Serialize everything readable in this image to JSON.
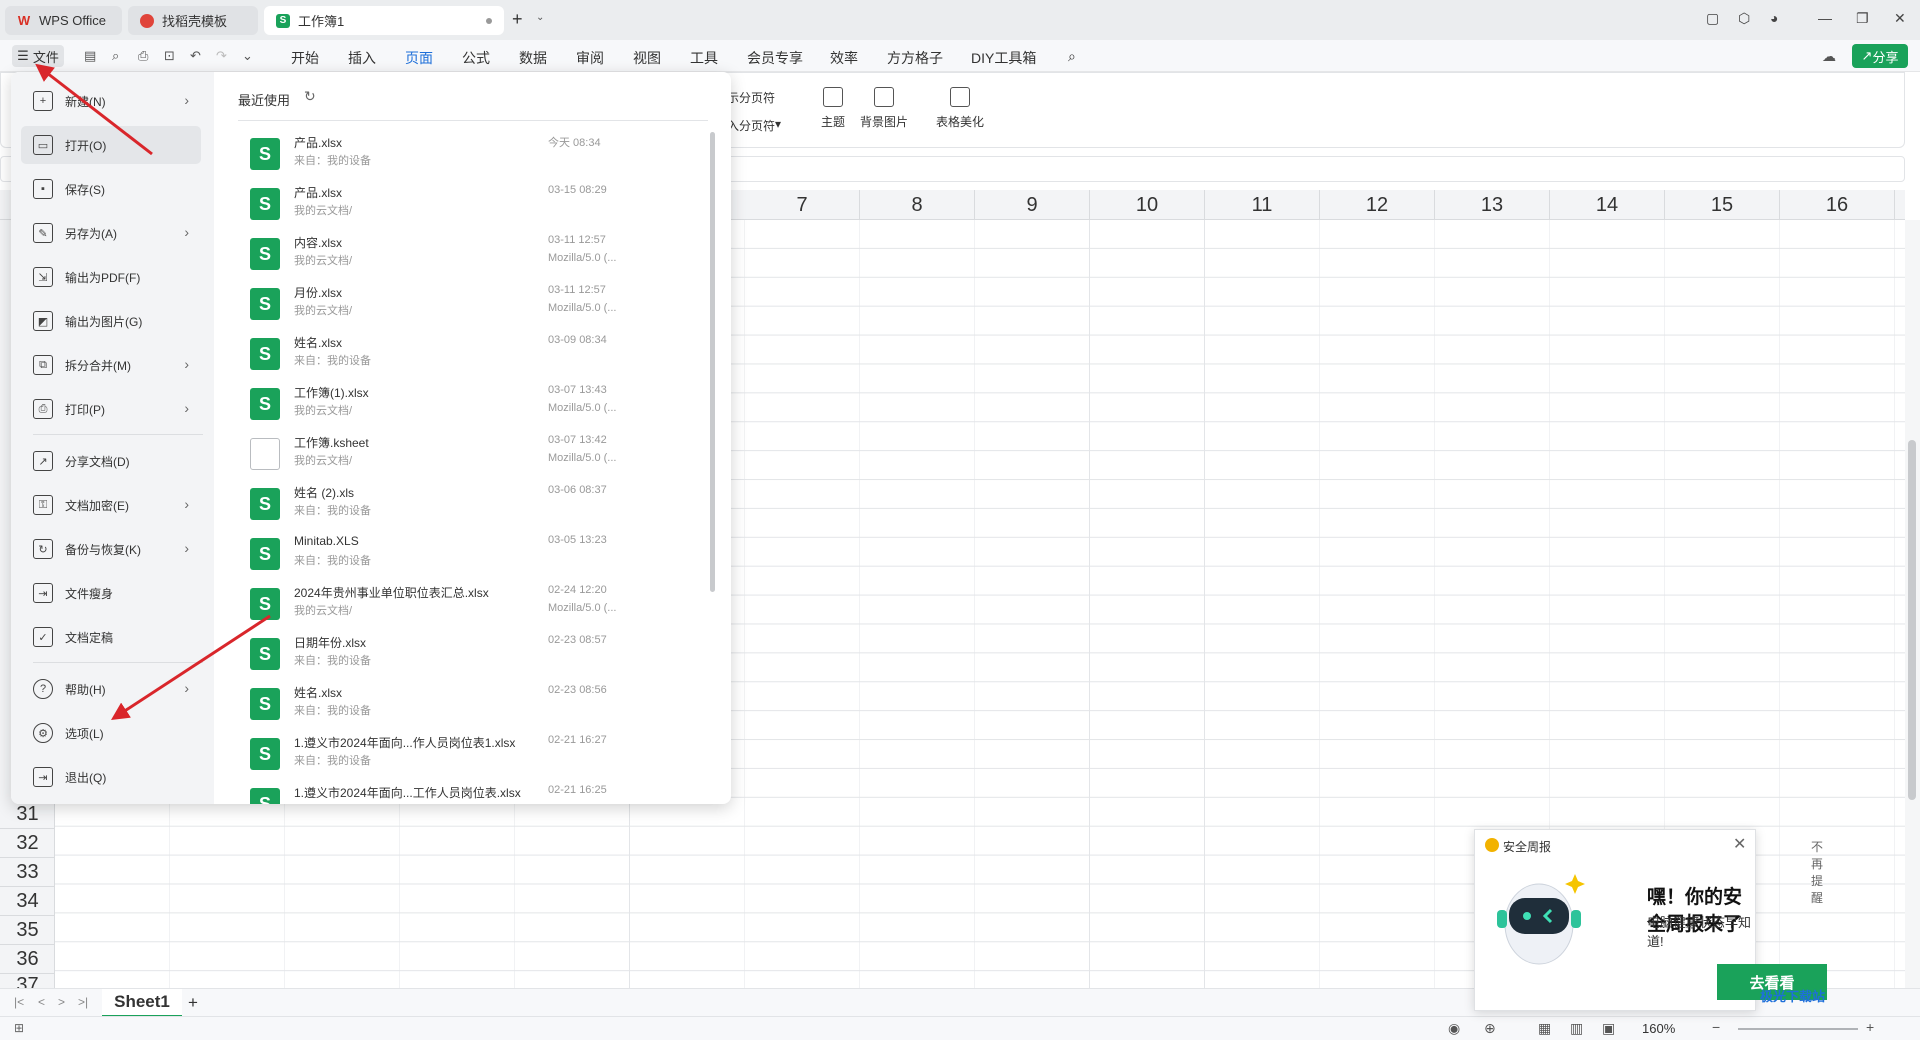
{
  "titlebar": {
    "tabs": [
      {
        "label": "WPS Office"
      },
      {
        "label": "找稻壳模板"
      },
      {
        "label": "工作簿1"
      }
    ]
  },
  "menubar": {
    "file_label": "文件",
    "items": [
      "开始",
      "插入",
      "页面",
      "公式",
      "数据",
      "审阅",
      "视图",
      "工具",
      "会员专享",
      "效率",
      "方方格子",
      "DIY工具箱"
    ],
    "active": "页面",
    "share_label": "分享"
  },
  "ribbon": {
    "partial_items": [
      "示分页符",
      "入分页符"
    ],
    "items": [
      "主题",
      "背景图片",
      "表格美化"
    ]
  },
  "grid": {
    "columns": [
      "7",
      "8",
      "9",
      "10",
      "11",
      "12",
      "13",
      "14",
      "15",
      "16"
    ],
    "rows": [
      "31",
      "32",
      "33",
      "34",
      "35",
      "36",
      "37"
    ]
  },
  "sheets": {
    "tabs": [
      "Sheet1"
    ],
    "zoom": "160%"
  },
  "filemenu": {
    "items": [
      {
        "label": "新建(N)",
        "icon": "new-doc-icon",
        "submenu": true
      },
      {
        "label": "打开(O)",
        "icon": "folder-open-icon",
        "submenu": false,
        "selected": true
      },
      {
        "label": "保存(S)",
        "icon": "save-icon",
        "submenu": false
      },
      {
        "label": "另存为(A)",
        "icon": "save-as-icon",
        "submenu": true
      },
      {
        "label": "输出为PDF(F)",
        "icon": "pdf-icon",
        "submenu": false
      },
      {
        "label": "输出为图片(G)",
        "icon": "image-icon",
        "submenu": false
      },
      {
        "label": "拆分合并(M)",
        "icon": "split-merge-icon",
        "submenu": true
      },
      {
        "label": "打印(P)",
        "icon": "print-icon",
        "submenu": true
      },
      {
        "label": "分享文档(D)",
        "icon": "share-icon",
        "submenu": false
      },
      {
        "label": "文档加密(E)",
        "icon": "lock-icon",
        "submenu": true
      },
      {
        "label": "备份与恢复(K)",
        "icon": "backup-icon",
        "submenu": true
      },
      {
        "label": "文件瘦身",
        "icon": "compress-icon",
        "submenu": false
      },
      {
        "label": "文档定稿",
        "icon": "finalize-icon",
        "submenu": false
      },
      {
        "label": "帮助(H)",
        "icon": "help-icon",
        "submenu": true
      },
      {
        "label": "选项(L)",
        "icon": "gear-icon",
        "submenu": false
      },
      {
        "label": "退出(Q)",
        "icon": "exit-icon",
        "submenu": false
      }
    ],
    "recent_title": "最近使用",
    "recent_files": [
      {
        "name": "产品.xlsx",
        "source": "来自：我的设备",
        "time": "今天 08:34",
        "agent": ""
      },
      {
        "name": "产品.xlsx",
        "source": "我的云文档/",
        "time": "03-15 08:29",
        "agent": ""
      },
      {
        "name": "内容.xlsx",
        "source": "我的云文档/",
        "time": "03-11 12:57",
        "agent": "Mozilla/5.0 (..."
      },
      {
        "name": "月份.xlsx",
        "source": "我的云文档/",
        "time": "03-11 12:57",
        "agent": "Mozilla/5.0 (..."
      },
      {
        "name": "姓名.xlsx",
        "source": "来自：我的设备",
        "time": "03-09 08:34",
        "agent": ""
      },
      {
        "name": "工作簿(1).xlsx",
        "source": "我的云文档/",
        "time": "03-07 13:43",
        "agent": "Mozilla/5.0 (..."
      },
      {
        "name": "工作簿.ksheet",
        "source": "我的云文档/",
        "time": "03-07 13:42",
        "agent": "Mozilla/5.0 (...",
        "blank": true
      },
      {
        "name": "姓名 (2).xls",
        "source": "来自：我的设备",
        "time": "03-06 08:37",
        "agent": ""
      },
      {
        "name": "Minitab.XLS",
        "source": "来自：我的设备",
        "time": "03-05 13:23",
        "agent": ""
      },
      {
        "name": "2024年贵州事业单位职位表汇总.xlsx",
        "source": "我的云文档/",
        "time": "02-24 12:20",
        "agent": "Mozilla/5.0 (..."
      },
      {
        "name": "日期年份.xlsx",
        "source": "来自：我的设备",
        "time": "02-23 08:57",
        "agent": ""
      },
      {
        "name": "姓名.xlsx",
        "source": "来自：我的设备",
        "time": "02-23 08:56",
        "agent": ""
      },
      {
        "name": "1.遵义市2024年面向...作人员岗位表1.xlsx",
        "source": "来自：我的设备",
        "time": "02-21 16:27",
        "agent": ""
      },
      {
        "name": "1.遵义市2024年面向...工作人员岗位表.xlsx",
        "source": "",
        "time": "02-21 16:25",
        "agent": ""
      }
    ]
  },
  "popup": {
    "label": "安全周报",
    "dismiss": "不再提醒",
    "title": "嘿！你的安全周报来了",
    "subtitle": "电脑健康状态早知道!",
    "button": "去看看"
  },
  "watermark": "极光下载站",
  "colors": {
    "accent": "#1aa25a",
    "active_tab": "#1e6fd9",
    "arrow": "#d9262b"
  }
}
